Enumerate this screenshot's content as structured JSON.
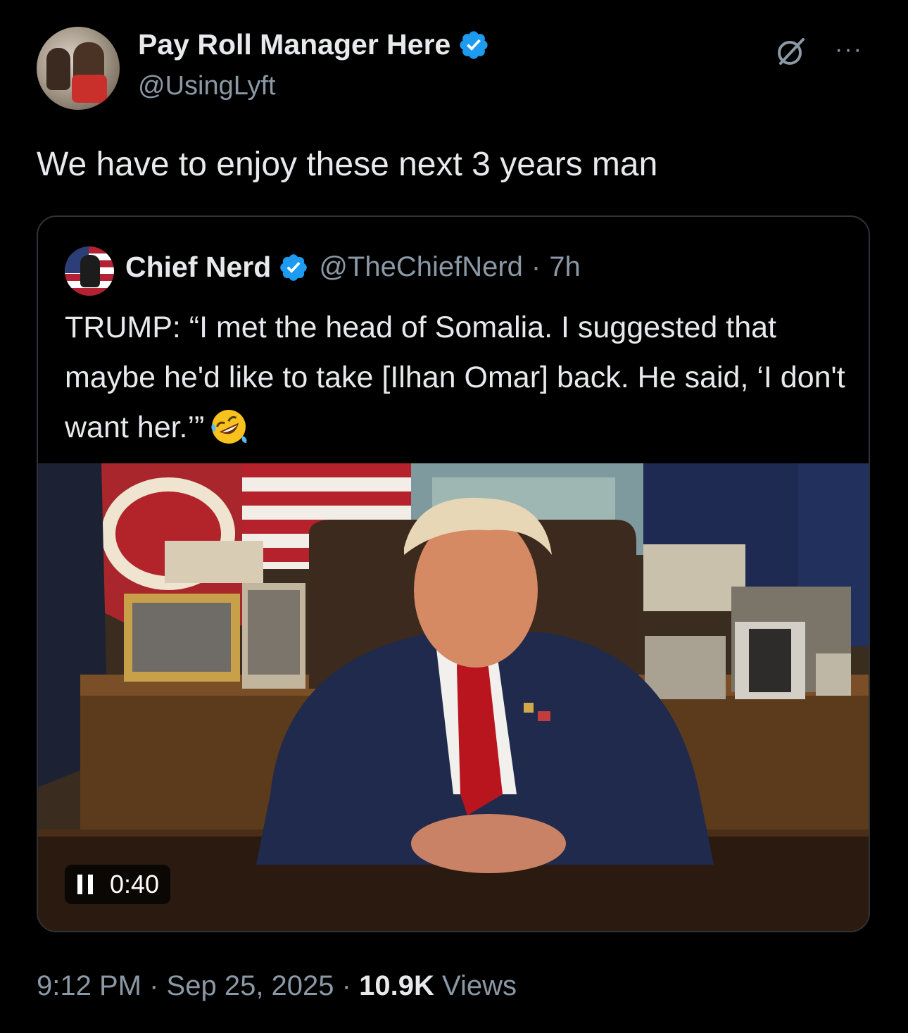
{
  "tweet": {
    "author": {
      "display_name": "Pay Roll Manager Here",
      "handle": "@UsingLyft",
      "verified": true
    },
    "text": "We have to enjoy these next 3 years man",
    "icons": {
      "grok": "grok-icon",
      "more": "more-options-icon",
      "more_glyph": "···"
    },
    "timestamp": "9:12 PM",
    "separator": "·",
    "date": "Sep 25, 2025",
    "views_count": "10.9K",
    "views_label": "Views"
  },
  "quote": {
    "author": {
      "display_name": "Chief Nerd",
      "handle": "@TheChiefNerd",
      "verified": true
    },
    "separator": "·",
    "time_ago": "7h",
    "text": "TRUMP: “I met the head of Somalia. I suggested that maybe he'd like to take [Ilhan Omar] back. He said, ‘I don't want her.’”",
    "emoji": "rolling-on-the-floor-laughing-emoji",
    "video": {
      "elapsed": "0:40",
      "state": "playing",
      "control_icon": "pause-icon"
    }
  },
  "colors": {
    "background": "#000000",
    "text_primary": "#e7e9ea",
    "text_secondary": "#8b98a5",
    "verified_blue": "#1d9bf0",
    "border": "#2f3336"
  }
}
